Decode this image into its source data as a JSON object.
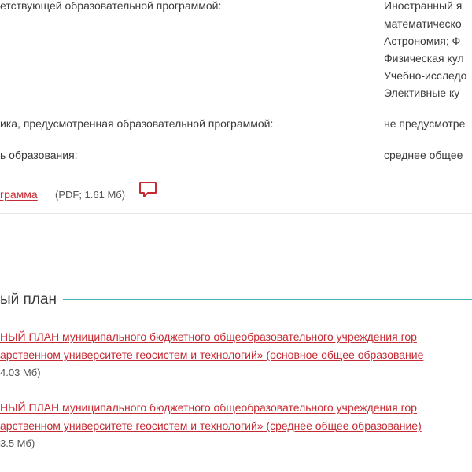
{
  "program": {
    "left_top": "етствующей образовательной программой:",
    "subjects": [
      "Иностранный я",
      "математическо",
      "Астрономия; Ф",
      "Физическая кул",
      "Учебно-исследо",
      "Элективные ку"
    ],
    "practice_label": "ика, предусмотренная образовательной программой:",
    "practice_value": "не предусмотре",
    "level_label": "ь образования:",
    "level_value": "среднее общее",
    "file_link": "грамма",
    "file_meta": "(PDF; 1.61 Мб)",
    "comment_icon": "speech-bubble-icon"
  },
  "section": {
    "title": "ый план",
    "accent": "#46b1b5"
  },
  "docs": [
    {
      "line1": "НЫЙ ПЛАН муниципального бюджетного общеобразовательного учреждения гор",
      "line2": "арственном университете геосистем и технологий» (основное общее образование",
      "meta": "4.03 Мб)"
    },
    {
      "line1": "НЫЙ ПЛАН муниципального бюджетного общеобразовательного учреждения гор",
      "line2": "арственном университете геосистем и технологий» (среднее общее образование)",
      "meta": "3.5 Мб)"
    }
  ],
  "colors": {
    "link": "#c62a32",
    "text": "#3a3a3a",
    "divider": "#e5e5e5"
  }
}
